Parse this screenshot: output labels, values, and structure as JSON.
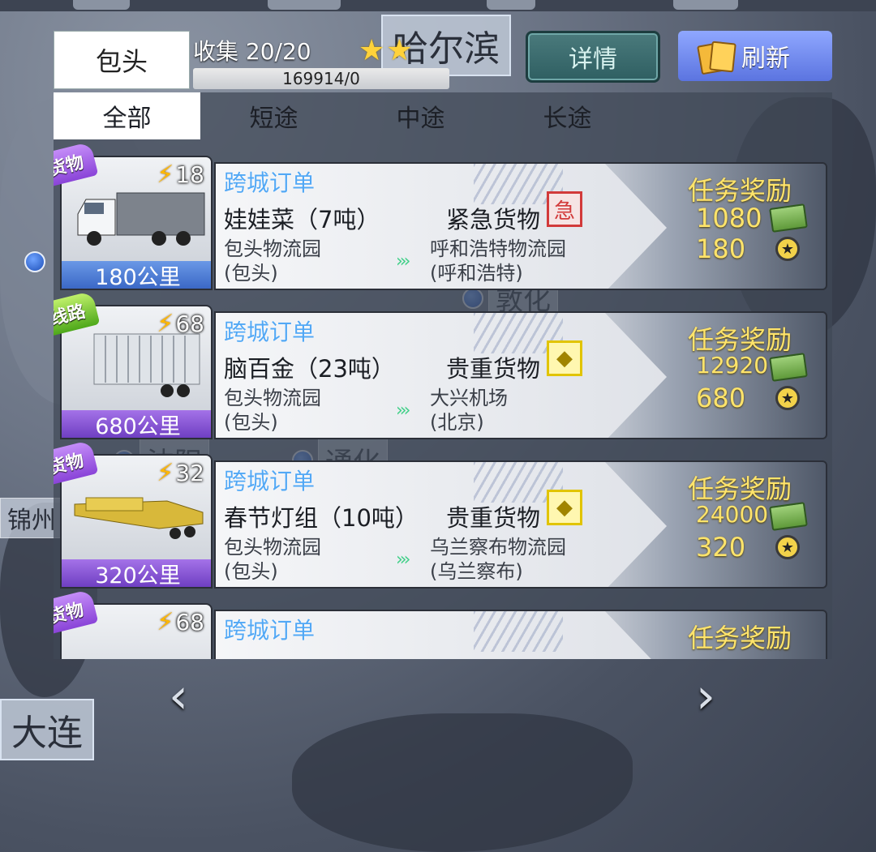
{
  "header": {
    "city": "包头",
    "collect_label": "收集 20/20",
    "stars": "★★",
    "progress_text": "169914/0",
    "detail_button": "详情",
    "refresh_button": "刷新"
  },
  "filters": [
    "全部",
    "短途",
    "中途",
    "长途"
  ],
  "orders": [
    {
      "tag": "新货物",
      "energy": "18",
      "distance": "180公里",
      "order_type": "跨城订单",
      "cargo": "娃娃菜（7吨）",
      "cargo_type": "紧急货物",
      "cargo_icon_glyph": "急",
      "from_name": "包头物流园",
      "from_city": "(包头)",
      "to_name": "呼和浩特物流园",
      "to_city": "(呼和浩特)",
      "reward_title": "任务奖励",
      "reward_money": "1080",
      "reward_star": "180"
    },
    {
      "tag": "新线路",
      "energy": "68",
      "distance": "680公里",
      "order_type": "跨城订单",
      "cargo": "脑百金（23吨）",
      "cargo_type": "贵重货物",
      "cargo_icon_glyph": "◆",
      "from_name": "包头物流园",
      "from_city": "(包头)",
      "to_name": "大兴机场",
      "to_city": "(北京)",
      "reward_title": "任务奖励",
      "reward_money": "12920",
      "reward_star": "680"
    },
    {
      "tag": "新货物",
      "energy": "32",
      "distance": "320公里",
      "order_type": "跨城订单",
      "cargo": "春节灯组（10吨）",
      "cargo_type": "贵重货物",
      "cargo_icon_glyph": "◆",
      "from_name": "包头物流园",
      "from_city": "(包头)",
      "to_name": "乌兰察布物流园",
      "to_city": "(乌兰察布)",
      "reward_title": "任务奖励",
      "reward_money": "24000",
      "reward_star": "320"
    },
    {
      "tag": "新货物",
      "energy": "68",
      "order_type": "跨城订单",
      "reward_title": "任务奖励"
    }
  ],
  "map": {
    "city_harbin": "哈尔滨",
    "city_dalian": "大连",
    "city_jinzhou": "锦州",
    "city_tonghua": "通化",
    "city_shenyang": "沈阳",
    "city_dunhua": "敦化"
  },
  "nav": {
    "prev": "‹",
    "next": "›"
  },
  "colors": {
    "accent_blue": "#52a8f5",
    "reward_gold": "#ffe46b",
    "tag_purple": "#8a44d8",
    "tag_green": "#4ea81a"
  }
}
